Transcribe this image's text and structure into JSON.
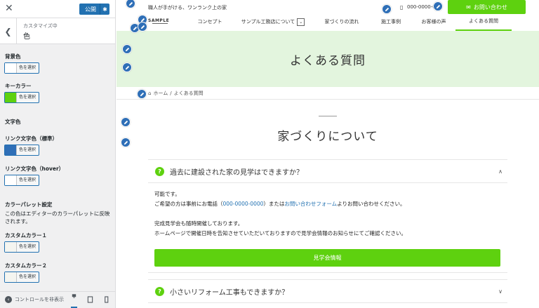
{
  "sidebar": {
    "close_icon": "close-icon",
    "publish_label": "公開",
    "back_icon": "chevron-left-icon",
    "customizing_label": "カスタマイズ中",
    "section_title": "色",
    "color_select_label": "色を選択",
    "controls": {
      "bg_color": "背景色",
      "key_color": "キーカラー",
      "text_color_heading": "文字色",
      "link_color": "リンク文字色（標準）",
      "link_hover_color": "リンク文字色（hover）",
      "palette_heading": "カラーパレット設定",
      "palette_note": "この色はエディターのカラーパレットに反映されます。",
      "custom1": "カスタムカラー１",
      "custom2": "カスタムカラー２"
    },
    "swatches": {
      "bg": "#ffffff",
      "key": "#5ed10f",
      "link": "#2f6fb7",
      "hover": "#ffffff",
      "custom1": "#f5f5f0",
      "custom2": "#f5f5f0"
    },
    "footer": {
      "hide_controls": "コントロールを非表示"
    }
  },
  "preview": {
    "tagline": "職人が手がける、ワンランク上の家",
    "phone": "000-0000-0000",
    "contact_button": "お問い合わせ",
    "logo": "SAMPLE",
    "nav": [
      "コンセプト",
      "サンプル工務店について",
      "家づくりの流れ",
      "施工事例",
      "お客様の声",
      "よくある質問"
    ],
    "hero_title": "よくある質問",
    "breadcrumb": {
      "home": "ホーム",
      "sep": "/",
      "current": "よくある質問"
    },
    "section_title": "家づくりについて",
    "faq": [
      {
        "q_mark": "?",
        "question": "過去に建設された家の見学はできますか？",
        "answer": {
          "line1": "可能です。",
          "line2_a": "ご希望の方は事前にお電話（",
          "line2_phone": "000-0000-0000",
          "line2_b": "）または",
          "line2_link": "お問い合わせフォーム",
          "line2_c": "よりお問い合わせください。",
          "line3": "完成見学会も随時開催しております。",
          "line4": "ホームページで開催日時を告知させていただいておりますので見学会情報のお知らせにてご確認ください。"
        },
        "button": "見学会情報"
      },
      {
        "q_mark": "?",
        "question": "小さいリフォーム工事もできますか？"
      }
    ]
  }
}
